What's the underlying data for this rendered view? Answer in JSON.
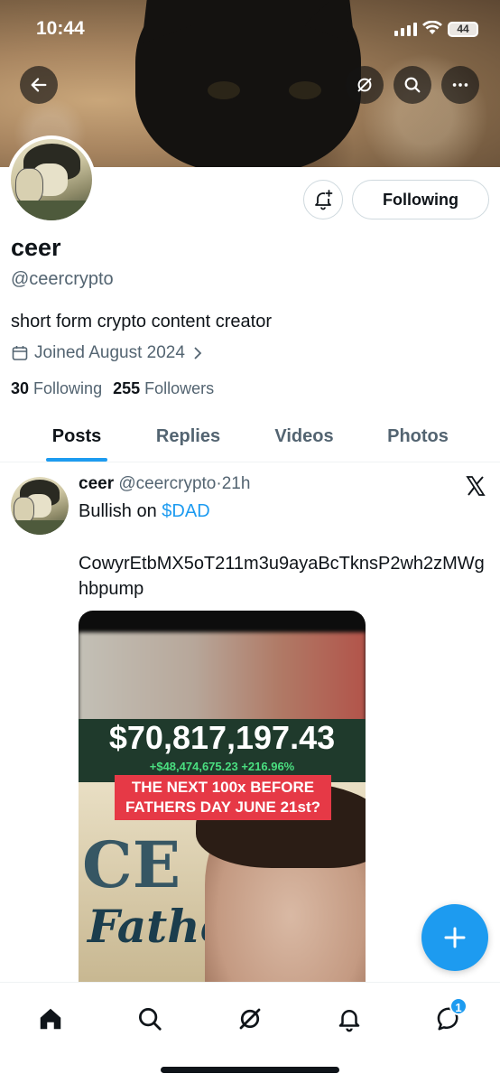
{
  "status_bar": {
    "time": "10:44",
    "battery": "44"
  },
  "profile": {
    "name": "ceer",
    "handle": "@ceercrypto",
    "bio": "short form crypto content creator",
    "joined": "Joined August 2024",
    "following_count": "30",
    "following_label": "Following",
    "followers_count": "255",
    "followers_label": "Followers",
    "follow_button": "Following"
  },
  "tabs": [
    "Posts",
    "Replies",
    "Videos",
    "Photos"
  ],
  "active_tab": "Posts",
  "post": {
    "name": "ceer",
    "handle": "@ceercrypto",
    "separator": "·",
    "time": "21h",
    "text_prefix": "Bullish on ",
    "cashtag": "$DAD",
    "contract": "CowyrEtbMX5oT211m3u9ayaBcTknsP2wh2zMWghbpump",
    "media": {
      "price": "$70,817,197.43",
      "gain": "+$48,474,675.23  +216.96%",
      "headline_line1": "THE NEXT 100x BEFORE",
      "headline_line2": "FATHERS DAY JUNE 21st?",
      "poster_text1": "CE",
      "poster_text2": "Father"
    }
  },
  "nav": {
    "messages_badge": "1"
  },
  "colors": {
    "accent": "#1d9bf0",
    "text": "#0f1419",
    "secondary": "#536471"
  },
  "icons": [
    "back-arrow-icon",
    "grok-icon",
    "search-icon",
    "more-icon",
    "bell-plus-icon",
    "calendar-icon",
    "chevron-right-icon",
    "x-logo-icon",
    "plus-icon",
    "home-icon",
    "grok-icon",
    "bell-icon",
    "messages-icon"
  ]
}
